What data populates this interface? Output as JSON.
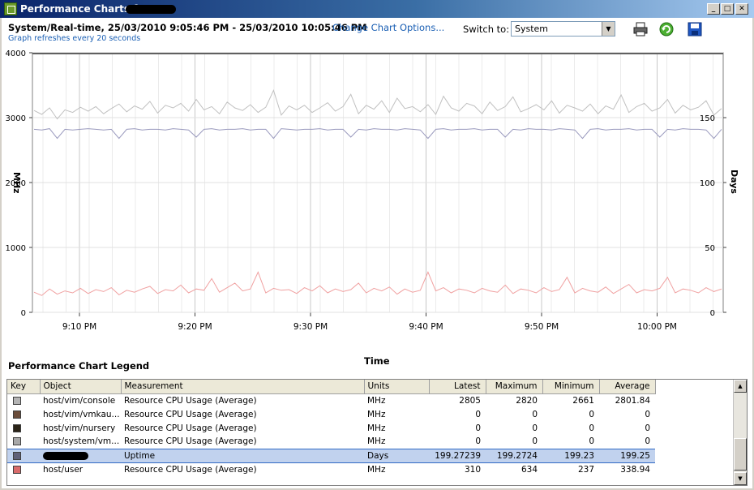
{
  "window": {
    "title": "Performance Charts for",
    "minimize_glyph": "_",
    "maximize_glyph": "□",
    "close_glyph": "✕"
  },
  "header": {
    "range_text": "System/Real-time, 25/03/2010 9:05:46 PM - 25/03/2010 10:05:46 PM",
    "change_link": "Change Chart Options...",
    "refresh_note": "Graph refreshes every 20 seconds",
    "switch_label": "Switch to:",
    "switch_value": "System",
    "dropdown_arrow": "▼",
    "icons": [
      "printer-icon",
      "refresh-icon",
      "save-icon"
    ]
  },
  "chart_data": {
    "type": "line",
    "xlabel": "Time",
    "ylabel_left": "MHz",
    "ylabel_right": "Days",
    "x_ticks": [
      "9:10 PM",
      "9:20 PM",
      "9:30 PM",
      "9:40 PM",
      "9:50 PM",
      "10:00 PM"
    ],
    "y_left_ticks": [
      "0",
      "1000",
      "2000",
      "3000",
      "4000"
    ],
    "y_right_ticks": [
      "0",
      "50",
      "100",
      "150"
    ],
    "ylim_left": [
      0,
      4000
    ],
    "ylim_right": [
      0,
      200
    ],
    "grid": true,
    "series": [
      {
        "name": "host/vim/console",
        "axis": "left",
        "color": "#c0c0c0",
        "values": [
          3110,
          3050,
          3150,
          2980,
          3120,
          3080,
          3160,
          3100,
          3170,
          3060,
          3140,
          3210,
          3090,
          3180,
          3130,
          3250,
          3070,
          3190,
          3150,
          3220,
          3100,
          3280,
          3120,
          3170,
          3060,
          3240,
          3150,
          3110,
          3200,
          3080,
          3160,
          3420,
          3040,
          3180,
          3120,
          3190,
          3080,
          3150,
          3230,
          3100,
          3170,
          3360,
          3060,
          3190,
          3130,
          3260,
          3080,
          3300,
          3140,
          3170,
          3090,
          3200,
          3050,
          3330,
          3150,
          3100,
          3220,
          3180,
          3060,
          3240,
          3110,
          3170,
          3320,
          3090,
          3140,
          3200,
          3120,
          3260,
          3070,
          3190,
          3150,
          3100,
          3210,
          3060,
          3180,
          3130,
          3350,
          3080,
          3170,
          3220,
          3100,
          3150,
          3280,
          3070,
          3190,
          3120,
          3160,
          3260,
          3040,
          3140
        ]
      },
      {
        "name": "host/system/vm...",
        "axis": "left",
        "color": "#9a9abe",
        "values": [
          2820,
          2810,
          2830,
          2680,
          2820,
          2810,
          2820,
          2830,
          2820,
          2810,
          2820,
          2680,
          2820,
          2830,
          2810,
          2820,
          2820,
          2810,
          2830,
          2820,
          2810,
          2700,
          2820,
          2830,
          2810,
          2820,
          2820,
          2830,
          2810,
          2820,
          2820,
          2680,
          2830,
          2820,
          2810,
          2820,
          2820,
          2830,
          2810,
          2820,
          2820,
          2700,
          2820,
          2810,
          2830,
          2820,
          2820,
          2810,
          2830,
          2820,
          2810,
          2680,
          2820,
          2830,
          2810,
          2820,
          2820,
          2830,
          2810,
          2820,
          2820,
          2700,
          2820,
          2810,
          2830,
          2820,
          2820,
          2810,
          2830,
          2820,
          2810,
          2680,
          2820,
          2830,
          2810,
          2820,
          2820,
          2830,
          2810,
          2820,
          2820,
          2700,
          2820,
          2810,
          2830,
          2820,
          2820,
          2810,
          2680,
          2820
        ]
      },
      {
        "name": "host/user",
        "axis": "left",
        "color": "#f0a0a0",
        "values": [
          310,
          260,
          360,
          280,
          330,
          300,
          370,
          290,
          350,
          320,
          380,
          270,
          340,
          310,
          360,
          400,
          290,
          350,
          330,
          420,
          300,
          360,
          340,
          520,
          310,
          380,
          450,
          330,
          360,
          620,
          300,
          370,
          340,
          350,
          290,
          380,
          330,
          410,
          300,
          360,
          320,
          350,
          450,
          300,
          370,
          330,
          390,
          280,
          360,
          310,
          340,
          620,
          330,
          380,
          300,
          360,
          340,
          300,
          370,
          330,
          310,
          420,
          290,
          360,
          340,
          300,
          380,
          320,
          350,
          540,
          300,
          370,
          330,
          310,
          390,
          290,
          360,
          430,
          300,
          350,
          330,
          370,
          540,
          300,
          360,
          340,
          300,
          380,
          320,
          360
        ]
      }
    ]
  },
  "legend": {
    "title": "Performance Chart Legend",
    "columns": [
      "Key",
      "Object",
      "Measurement",
      "Units",
      "Latest",
      "Maximum",
      "Minimum",
      "Average"
    ],
    "rows": [
      {
        "color": "#b4b4b4",
        "object": "host/vim/console",
        "measurement": "Resource CPU Usage (Average)",
        "units": "MHz",
        "latest": "2805",
        "maximum": "2820",
        "minimum": "2661",
        "average": "2801.84",
        "selected": false
      },
      {
        "color": "#6b4d3b",
        "object": "host/vim/vmkau...",
        "measurement": "Resource CPU Usage (Average)",
        "units": "MHz",
        "latest": "0",
        "maximum": "0",
        "minimum": "0",
        "average": "0",
        "selected": false
      },
      {
        "color": "#2b2418",
        "object": "host/vim/nursery",
        "measurement": "Resource CPU Usage (Average)",
        "units": "MHz",
        "latest": "0",
        "maximum": "0",
        "minimum": "0",
        "average": "0",
        "selected": false
      },
      {
        "color": "#a8a8a8",
        "object": "host/system/vm...",
        "measurement": "Resource CPU Usage (Average)",
        "units": "MHz",
        "latest": "0",
        "maximum": "0",
        "minimum": "0",
        "average": "0",
        "selected": false
      },
      {
        "color": "#606078",
        "object": "",
        "measurement": "Uptime",
        "units": "Days",
        "latest": "199.27239",
        "maximum": "199.2724",
        "minimum": "199.23",
        "average": "199.25",
        "selected": true
      },
      {
        "color": "#d96b6b",
        "object": "host/user",
        "measurement": "Resource CPU Usage (Average)",
        "units": "MHz",
        "latest": "310",
        "maximum": "634",
        "minimum": "237",
        "average": "338.94",
        "selected": false
      }
    ],
    "scroll_up_glyph": "▲",
    "scroll_down_glyph": "▼"
  }
}
